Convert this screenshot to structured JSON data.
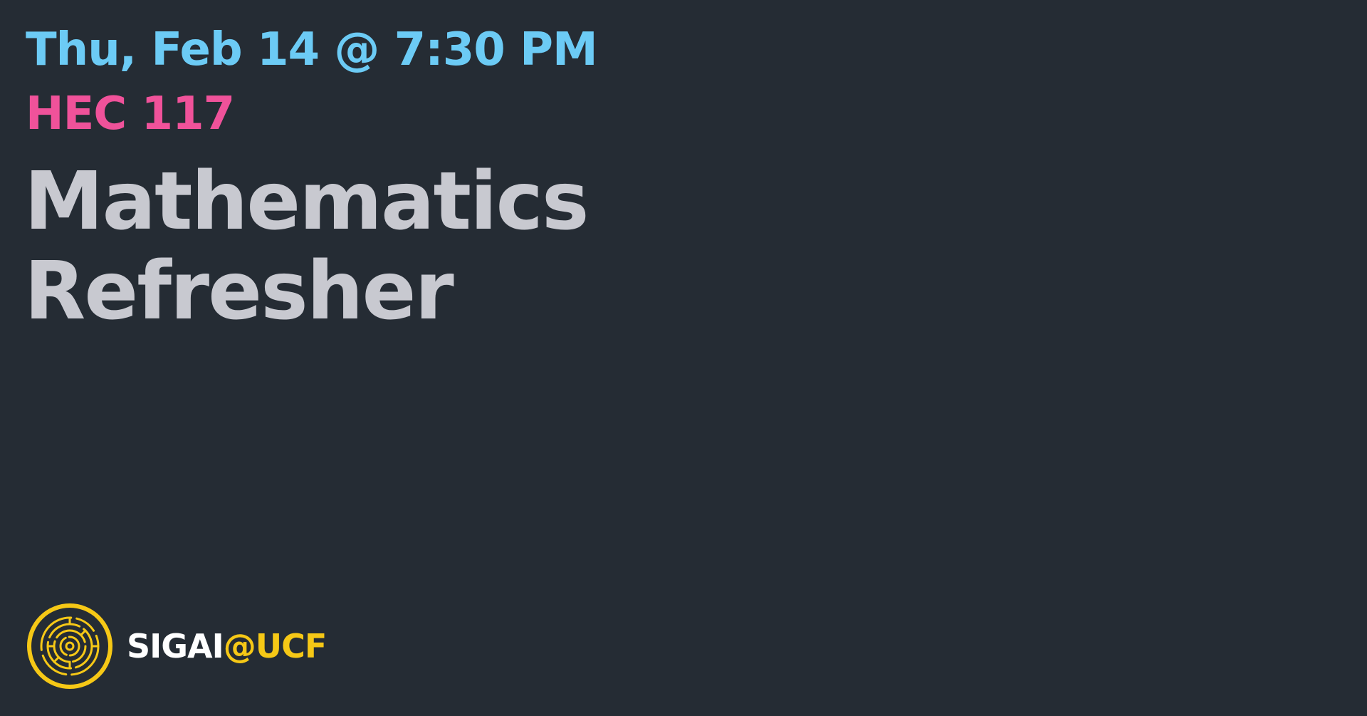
{
  "event": {
    "datetime": "Thu, Feb 14 @ 7:30 PM",
    "location": "HEC 117",
    "title_line1": "Mathematics",
    "title_line2": "Refresher"
  },
  "brand": {
    "name": "SIGAI",
    "suffix": "@UCF",
    "logo_icon": "circular-maze-logo-icon"
  },
  "colors": {
    "background": "#252c34",
    "datetime": "#6ccbf5",
    "location": "#f0529a",
    "title": "#c8c9d0",
    "brand_white": "#ffffff",
    "brand_gold": "#f6c816"
  }
}
